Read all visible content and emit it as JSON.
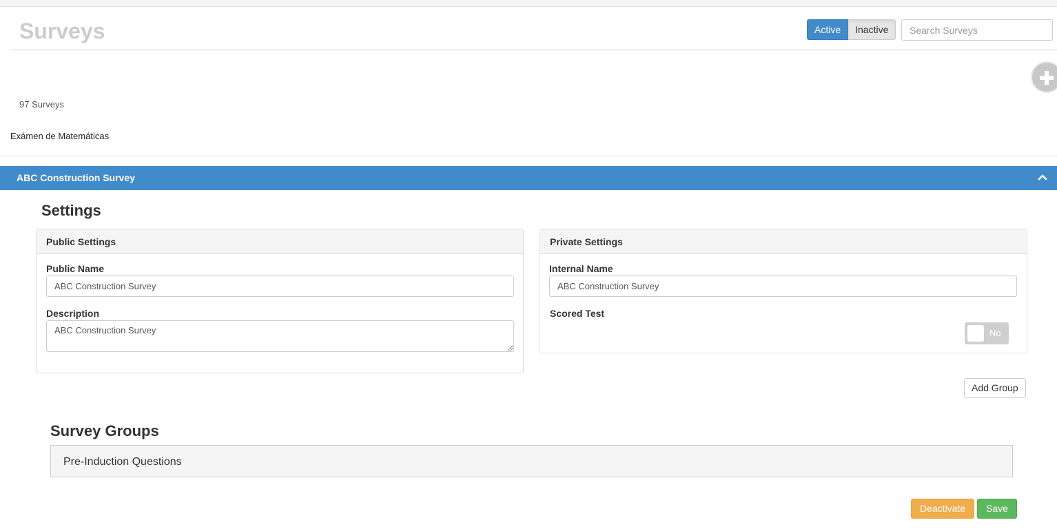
{
  "header": {
    "title": "Surveys",
    "filter": {
      "active_label": "Active",
      "inactive_label": "Inactive",
      "selected": "Active"
    },
    "search": {
      "placeholder": "Search Surveys",
      "value": ""
    },
    "add_icon": "plus-circle-icon"
  },
  "list": {
    "count_text": "97 Surveys",
    "items": [
      {
        "label": "Exámen de Matemáticas"
      }
    ]
  },
  "selected_survey": {
    "title": "ABC Construction Survey",
    "collapse_icon": "chevron-up-icon",
    "settings_heading": "Settings",
    "public_settings": {
      "heading": "Public Settings",
      "public_name_label": "Public Name",
      "public_name_value": "ABC Construction Survey",
      "description_label": "Description",
      "description_value": "ABC Construction Survey"
    },
    "private_settings": {
      "heading": "Private Settings",
      "internal_name_label": "Internal Name",
      "internal_name_value": "ABC Construction Survey",
      "scored_test_label": "Scored Test",
      "scored_test_state": "No"
    },
    "add_group_label": "Add Group",
    "groups_heading": "Survey Groups",
    "groups": [
      {
        "label": "Pre-Induction Questions"
      }
    ],
    "deactivate_label": "Deactivate",
    "save_label": "Save"
  },
  "colors": {
    "primary": "#428bca",
    "warning": "#f0ad4e",
    "success": "#5cb85c",
    "title_gray": "#cccccc"
  }
}
